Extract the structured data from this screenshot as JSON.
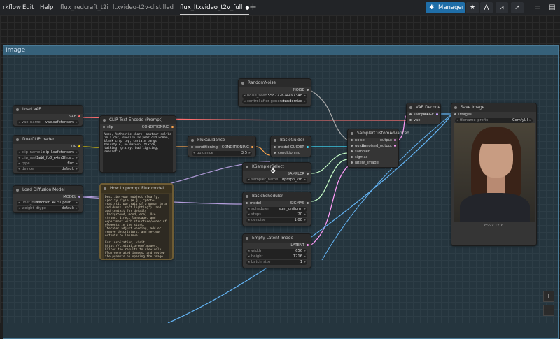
{
  "menu": {
    "workflow": "rkflow",
    "edit": "Edit",
    "help": "Help"
  },
  "tabs": [
    "flux_redcraft_t2i",
    "ltxvideo-t2v-distilled",
    "flux_ltxvideo_t2v_full"
  ],
  "active_dot": "●",
  "new_tab": "+",
  "manager": {
    "label": "Manager"
  },
  "group": {
    "title": "Image"
  },
  "nodes": {
    "load_vae": {
      "title": "Load VAE",
      "out": "VAE",
      "w_label": "vae_name",
      "w_value": "vae.safetensors"
    },
    "dual_clip": {
      "title": "DualCLIPLoader",
      "out": "CLIP",
      "w1_label": "clip_name1",
      "w1_value": "clip_l.safetensors",
      "w2_label": "clip_name2",
      "w2_value": "t5xxl_fp8_e4m3fn.s...",
      "w3_label": "type",
      "w3_value": "flux",
      "w4_label": "device",
      "w4_value": "default"
    },
    "load_diff": {
      "title": "Load Diffusion Model",
      "out": "MODEL",
      "w1_label": "unet_name",
      "w1_value": "redcraftCADSUpdat...",
      "w2_label": "weight_dtype",
      "w2_value": "default"
    },
    "clip_text": {
      "title": "CLIP Text Encode (Prompt)",
      "in": "clip",
      "out": "CONDITIONING",
      "text": "Vsco, Authentic share, amateur selfie in a car, swedish 18 year old woman, black crop top, curtain bangs hairstyle, no makeup, tiktok, talking, grainy, bad lighting, realistic"
    },
    "howto": {
      "title": "How to prompt Flux model",
      "text": "Describe your subject clearly, specify style (e.g., \"photo-realistic portrait of a woman in a red dress, soft lighting\"), and add context for details (background, mood, era). Use strong, direct language, and experiment with structure/order of elements in the start.\nIterate: adjust wording, add or remove descriptors, and review outputs to improve.\n\nFor inspiration, visit https://civitai.green/images. Filter the results to view only Flux-generated images, and review the prompts by opening the image details."
    },
    "guidance": {
      "title": "FluxGuidance",
      "in": "conditioning",
      "out": "CONDITIONING",
      "w_label": "guidance",
      "w_value": "3.5"
    },
    "random_noise": {
      "title": "RandomNoise",
      "out": "NOISE",
      "w1_label": "noise_seed",
      "w1_value": "558222624497348",
      "w2_label": "control after generate",
      "w2_value": "randomize"
    },
    "basic_guider": {
      "title": "BasicGuider",
      "in1": "model",
      "in2": "conditioning",
      "out": "GUIDER"
    },
    "ksampler_select": {
      "title": "KSamplerSelect",
      "out": "SAMPLER",
      "w_label": "sampler_name",
      "w_value": "dpmpp_2m"
    },
    "scheduler": {
      "title": "BasicScheduler",
      "in": "model",
      "out": "SIGMAS",
      "w1_label": "scheduler",
      "w1_value": "sgm_uniform",
      "w2_label": "steps",
      "w2_value": "20",
      "w3_label": "denoise",
      "w3_value": "1.00"
    },
    "latent": {
      "title": "Empty Latent Image",
      "out": "LATENT",
      "w1_label": "width",
      "w1_value": "656",
      "w2_label": "height",
      "w2_value": "1216",
      "w3_label": "batch_size",
      "w3_value": "1"
    },
    "sampler_adv": {
      "title": "SamplerCustomAdvanced",
      "in1": "noise",
      "in2": "guider",
      "in3": "sampler",
      "in4": "sigmas",
      "in5": "latent_image",
      "out1": "output",
      "out2": "denoised_output"
    },
    "vae_decode": {
      "title": "VAE Decode",
      "in1": "samples",
      "in2": "vae",
      "out": "IMAGE"
    },
    "save_image": {
      "title": "Save Image",
      "in": "images",
      "w_label": "filename_prefix",
      "w_value": "ComfyUI",
      "dims": "656 × 1216"
    }
  },
  "zoom": {
    "plus": "+",
    "minus": "−"
  }
}
